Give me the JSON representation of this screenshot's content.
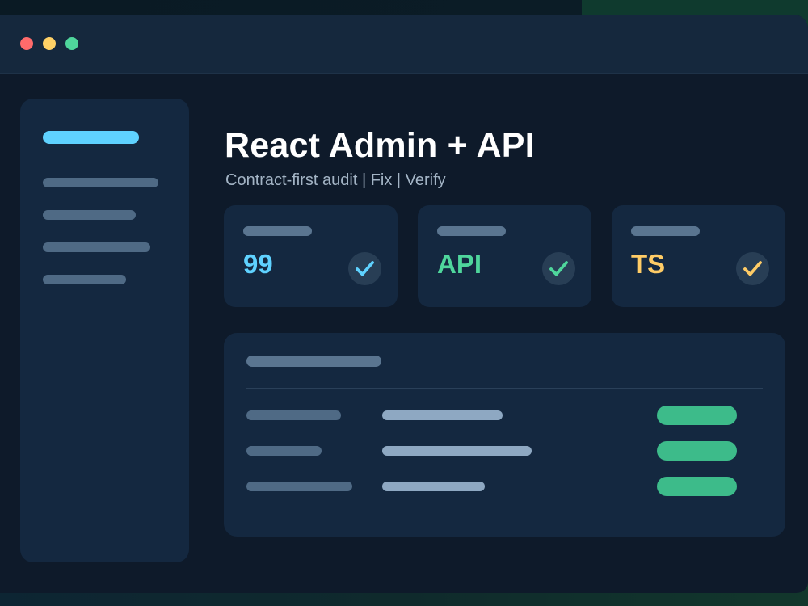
{
  "window": {
    "controls": [
      {
        "name": "close",
        "color": "#ff6b6b"
      },
      {
        "name": "minimize",
        "color": "#ffd166"
      },
      {
        "name": "maximize",
        "color": "#4fd69c"
      }
    ]
  },
  "header": {
    "title": "React Admin + API",
    "subtitle": "Contract-first audit  |  Fix  |  Verify"
  },
  "cards": [
    {
      "value": "99",
      "color": "#5fd2ff",
      "icon": "check-icon"
    },
    {
      "value": "API",
      "color": "#4fd69c",
      "icon": "check-icon"
    },
    {
      "value": "TS",
      "color": "#ffcc66",
      "icon": "check-icon"
    }
  ],
  "colors": {
    "accent": "#5fd2ff",
    "success": "#3dbb8a"
  }
}
